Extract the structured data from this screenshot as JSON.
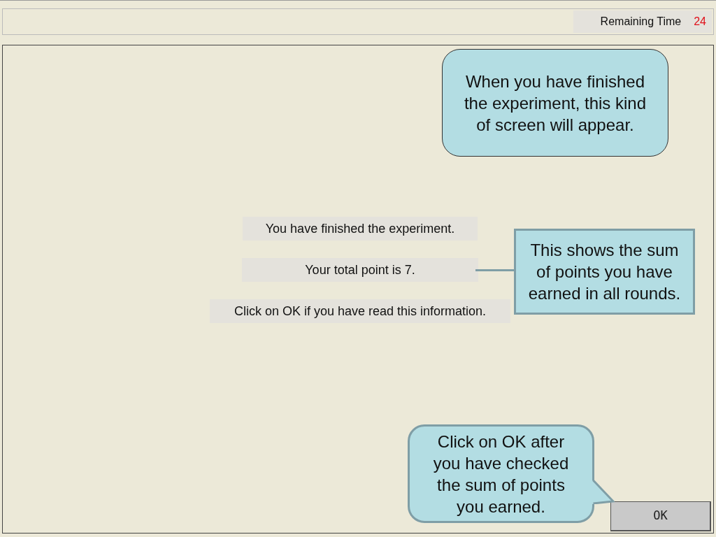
{
  "header": {
    "label": "Remaining Time",
    "value": "24"
  },
  "messages": [
    "You have finished the experiment.",
    "Your total point is 7.",
    "Click on OK if you have read this information."
  ],
  "button": "OK",
  "callouts": [
    {
      "kind": "rounded",
      "text": "When you have finished the experiment, this kind of screen will appear."
    },
    {
      "kind": "leader",
      "text": "This shows the sum of points you have earned in all rounds."
    },
    {
      "kind": "tail",
      "text": "Click on OK after you have checked the sum of points you earned."
    }
  ]
}
